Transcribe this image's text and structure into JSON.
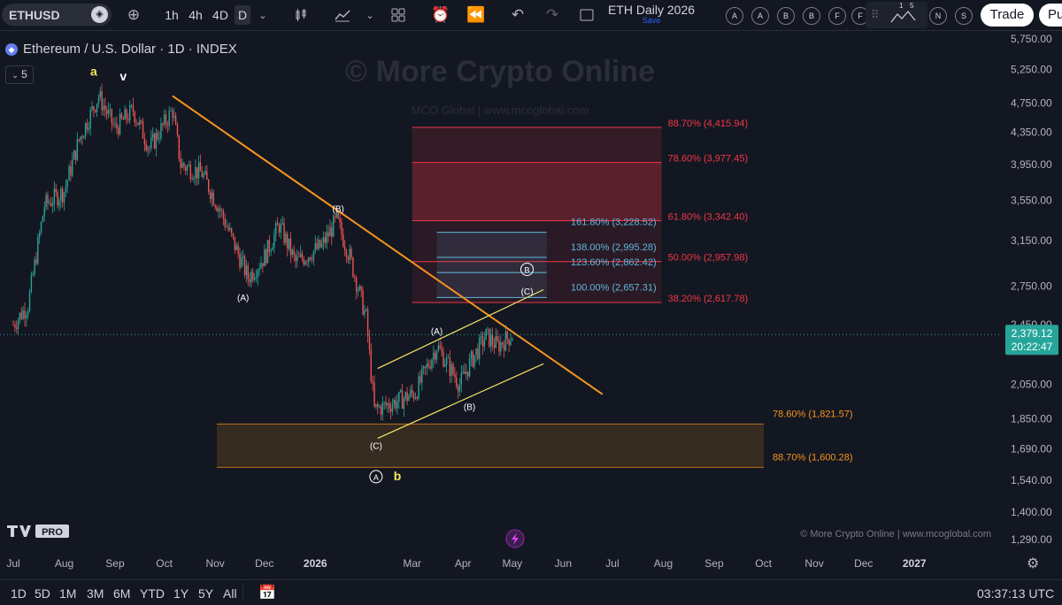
{
  "toolbar": {
    "symbol": "ETHUSD",
    "timeframes": [
      "1h",
      "4h",
      "4D",
      "D"
    ],
    "active_timeframe": "D",
    "layout_title": "ETH Daily 2026",
    "save_label": "Save",
    "circle_buttons": [
      "A",
      "A",
      "B",
      "B",
      "F",
      "F"
    ],
    "alert_buttons": [
      "N",
      "S"
    ],
    "indicator_numbers": [
      "1",
      "5"
    ],
    "trade_label": "Trade",
    "publish_label": "Pu"
  },
  "legend": {
    "title": "Ethereum / U.S. Dollar · 1D · INDEX",
    "indicator_count": "5"
  },
  "watermark": {
    "main": "© More Crypto Online",
    "sub": "MCO Global  |  www.mcoglobal.com",
    "footer": "© More Crypto Online  |  www.mcoglobal.com",
    "logo_text": "PRO"
  },
  "chart_data": {
    "type": "candlestick",
    "title": "Ethereum / U.S. Dollar · 1D · INDEX",
    "price_ticks": [
      5750,
      5250,
      4750,
      4350,
      3950,
      3550,
      3150,
      2750,
      2450,
      2050,
      1850,
      1690,
      1540,
      1400,
      1290
    ],
    "price_tick_labels": [
      "5,750.00",
      "5,250.00",
      "4,750.00",
      "4,350.00",
      "3,950.00",
      "3,550.00",
      "3,150.00",
      "2,750.00",
      "2,450.00",
      "2,050.00",
      "1,850.00",
      "1,690.00",
      "1,540.00",
      "1,400.00",
      "1,290.00"
    ],
    "time_labels": [
      "Jul",
      "Aug",
      "Sep",
      "Oct",
      "Nov",
      "Dec",
      "2026",
      "Mar",
      "Apr",
      "May",
      "Jun",
      "Jul",
      "Aug",
      "Sep",
      "Oct",
      "Nov",
      "Dec",
      "2027"
    ],
    "current_price": "2,379.12",
    "countdown": "20:22:47",
    "close_path": [
      [
        "2025-07-01",
        2450
      ],
      [
        "2025-07-10",
        2600
      ],
      [
        "2025-07-20",
        3500
      ],
      [
        "2025-08-01",
        3650
      ],
      [
        "2025-08-10",
        4250
      ],
      [
        "2025-08-22",
        4850
      ],
      [
        "2025-09-01",
        4400
      ],
      [
        "2025-09-12",
        4650
      ],
      [
        "2025-09-22",
        4150
      ],
      [
        "2025-10-06",
        4650
      ],
      [
        "2025-10-11",
        3950
      ],
      [
        "2025-10-24",
        3850
      ],
      [
        "2025-11-04",
        3450
      ],
      [
        "2025-11-21",
        2820
      ],
      [
        "2025-12-01",
        3000
      ],
      [
        "2025-12-10",
        3300
      ],
      [
        "2025-12-20",
        2950
      ],
      [
        "2026-01-05",
        3100
      ],
      [
        "2026-01-14",
        3350
      ],
      [
        "2026-01-22",
        3000
      ],
      [
        "2026-02-01",
        2500
      ],
      [
        "2026-02-06",
        1900
      ],
      [
        "2026-02-20",
        1950
      ],
      [
        "2026-03-03",
        2000
      ],
      [
        "2026-03-16",
        2300
      ],
      [
        "2026-03-30",
        2050
      ],
      [
        "2026-04-06",
        2200
      ],
      [
        "2026-04-15",
        2370
      ],
      [
        "2026-04-22",
        2300
      ],
      [
        "2026-05-01",
        2379
      ]
    ],
    "trendline": {
      "start": [
        "2025-10-06",
        4850
      ],
      "end": [
        "2026-06-25",
        1990
      ],
      "color": "#f7941d"
    },
    "channel_upper": {
      "start": [
        "2026-02-08",
        2150
      ],
      "end": [
        "2026-05-20",
        2720
      ],
      "color": "#f5e663"
    },
    "channel_lower": {
      "start": [
        "2026-02-08",
        1745
      ],
      "end": [
        "2026-05-20",
        2180
      ],
      "color": "#f5e663"
    },
    "fib_retracement": {
      "color": "#f23645",
      "start": "2026-03-01",
      "end": "2026-07-31",
      "levels": [
        {
          "label": "88.70% (4,415.94)",
          "price": 4415.94
        },
        {
          "label": "78.60% (3,977.45)",
          "price": 3977.45
        },
        {
          "label": "61.80% (3,342.40)",
          "price": 3342.4
        },
        {
          "label": "50.00% (2,957.98)",
          "price": 2957.98
        },
        {
          "label": "38.20% (2,617.78)",
          "price": 2617.78
        }
      ]
    },
    "fib_extension": {
      "color": "#5fb7dd",
      "start": "2026-03-16",
      "end": "2026-05-22",
      "levels": [
        {
          "label": "161.80% (3,228.52)",
          "price": 3228.52
        },
        {
          "label": "138.00% (2,995.28)",
          "price": 2995.28
        },
        {
          "label": "123.60% (2,862.42)",
          "price": 2862.42
        },
        {
          "label": "100.00% (2,657.31)",
          "price": 2657.31
        }
      ]
    },
    "support_zone": {
      "color": "#f7941d",
      "start": "2026-01-01",
      "end": "2026-11-01",
      "levels": [
        {
          "label": "78.60% (1,821.57)",
          "price": 1821.57
        },
        {
          "label": "88.70% (1,600.28)",
          "price": 1600.28
        }
      ]
    },
    "wave_labels": [
      {
        "text": "a",
        "date": "2025-08-19",
        "price": 5150,
        "color": "#f5e663",
        "circled": false
      },
      {
        "text": "v",
        "date": "2025-09-06",
        "price": 5080,
        "color": "#ffffff",
        "circled": false
      },
      {
        "text": "(A)",
        "date": "2025-11-18",
        "price": 2630,
        "color": "#ffffff",
        "circled": false
      },
      {
        "text": "(B)",
        "date": "2026-01-15",
        "price": 3430,
        "color": "#ffffff",
        "circled": false
      },
      {
        "text": "(C)",
        "date": "2026-02-07",
        "price": 1690,
        "color": "#ffffff",
        "circled": false
      },
      {
        "text": "A",
        "date": "2026-02-07",
        "price": 1540,
        "color": "#ffffff",
        "circled": true
      },
      {
        "text": "b",
        "date": "2026-02-20",
        "price": 1540,
        "color": "#f5e663",
        "circled": false
      },
      {
        "text": "(A)",
        "date": "2026-03-16",
        "price": 2380,
        "color": "#ffffff",
        "circled": false
      },
      {
        "text": "(B)",
        "date": "2026-04-05",
        "price": 1900,
        "color": "#ffffff",
        "circled": false
      },
      {
        "text": "B",
        "date": "2026-05-10",
        "price": 2860,
        "color": "#ffffff",
        "circled": true
      },
      {
        "text": "(C)",
        "date": "2026-05-10",
        "price": 2680,
        "color": "#ffffff",
        "circled": false
      }
    ]
  },
  "bottom": {
    "ranges": [
      "1D",
      "5D",
      "1M",
      "3M",
      "6M",
      "YTD",
      "1Y",
      "5Y",
      "All"
    ],
    "clock": "03:37:13 UTC"
  },
  "colors": {
    "background": "#131722",
    "up": "#26a69a",
    "down": "#ef5350",
    "price_badge": "#26a69a"
  }
}
